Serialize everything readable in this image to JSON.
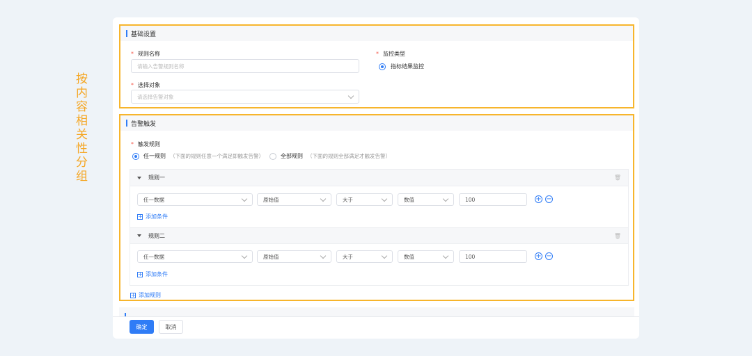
{
  "annotation": "按内容相关性分组",
  "basic": {
    "title": "基础设置",
    "rule_name_label": "规则名称",
    "rule_name_placeholder": "请输入告警规则名称",
    "monitor_type_label": "监控类型",
    "monitor_type_option": "指标结果监控",
    "object_label": "选择对象",
    "object_placeholder": "请选择告警对象"
  },
  "trigger": {
    "title": "告警触发",
    "rule_label": "触发规则",
    "options": [
      {
        "label": "任一规则",
        "hint": "（下面的规则任意一个满足即触发告警）",
        "selected": true
      },
      {
        "label": "全部规则",
        "hint": "（下面的规则全部满足才触发告警）",
        "selected": false
      }
    ],
    "rules": [
      {
        "title": "规则一",
        "data": "任一数据",
        "metric": "原始值",
        "op": "大于",
        "type": "数值",
        "value": "100",
        "add_condition": "添加条件"
      },
      {
        "title": "规则二",
        "data": "任一数据",
        "metric": "原始值",
        "op": "大于",
        "type": "数值",
        "value": "100",
        "add_condition": "添加条件"
      }
    ],
    "add_rule": "添加规则"
  },
  "footer": {
    "confirm": "确定",
    "cancel": "取消"
  },
  "colors": {
    "accent": "#2f7cf6",
    "highlight": "#f7b52c"
  }
}
